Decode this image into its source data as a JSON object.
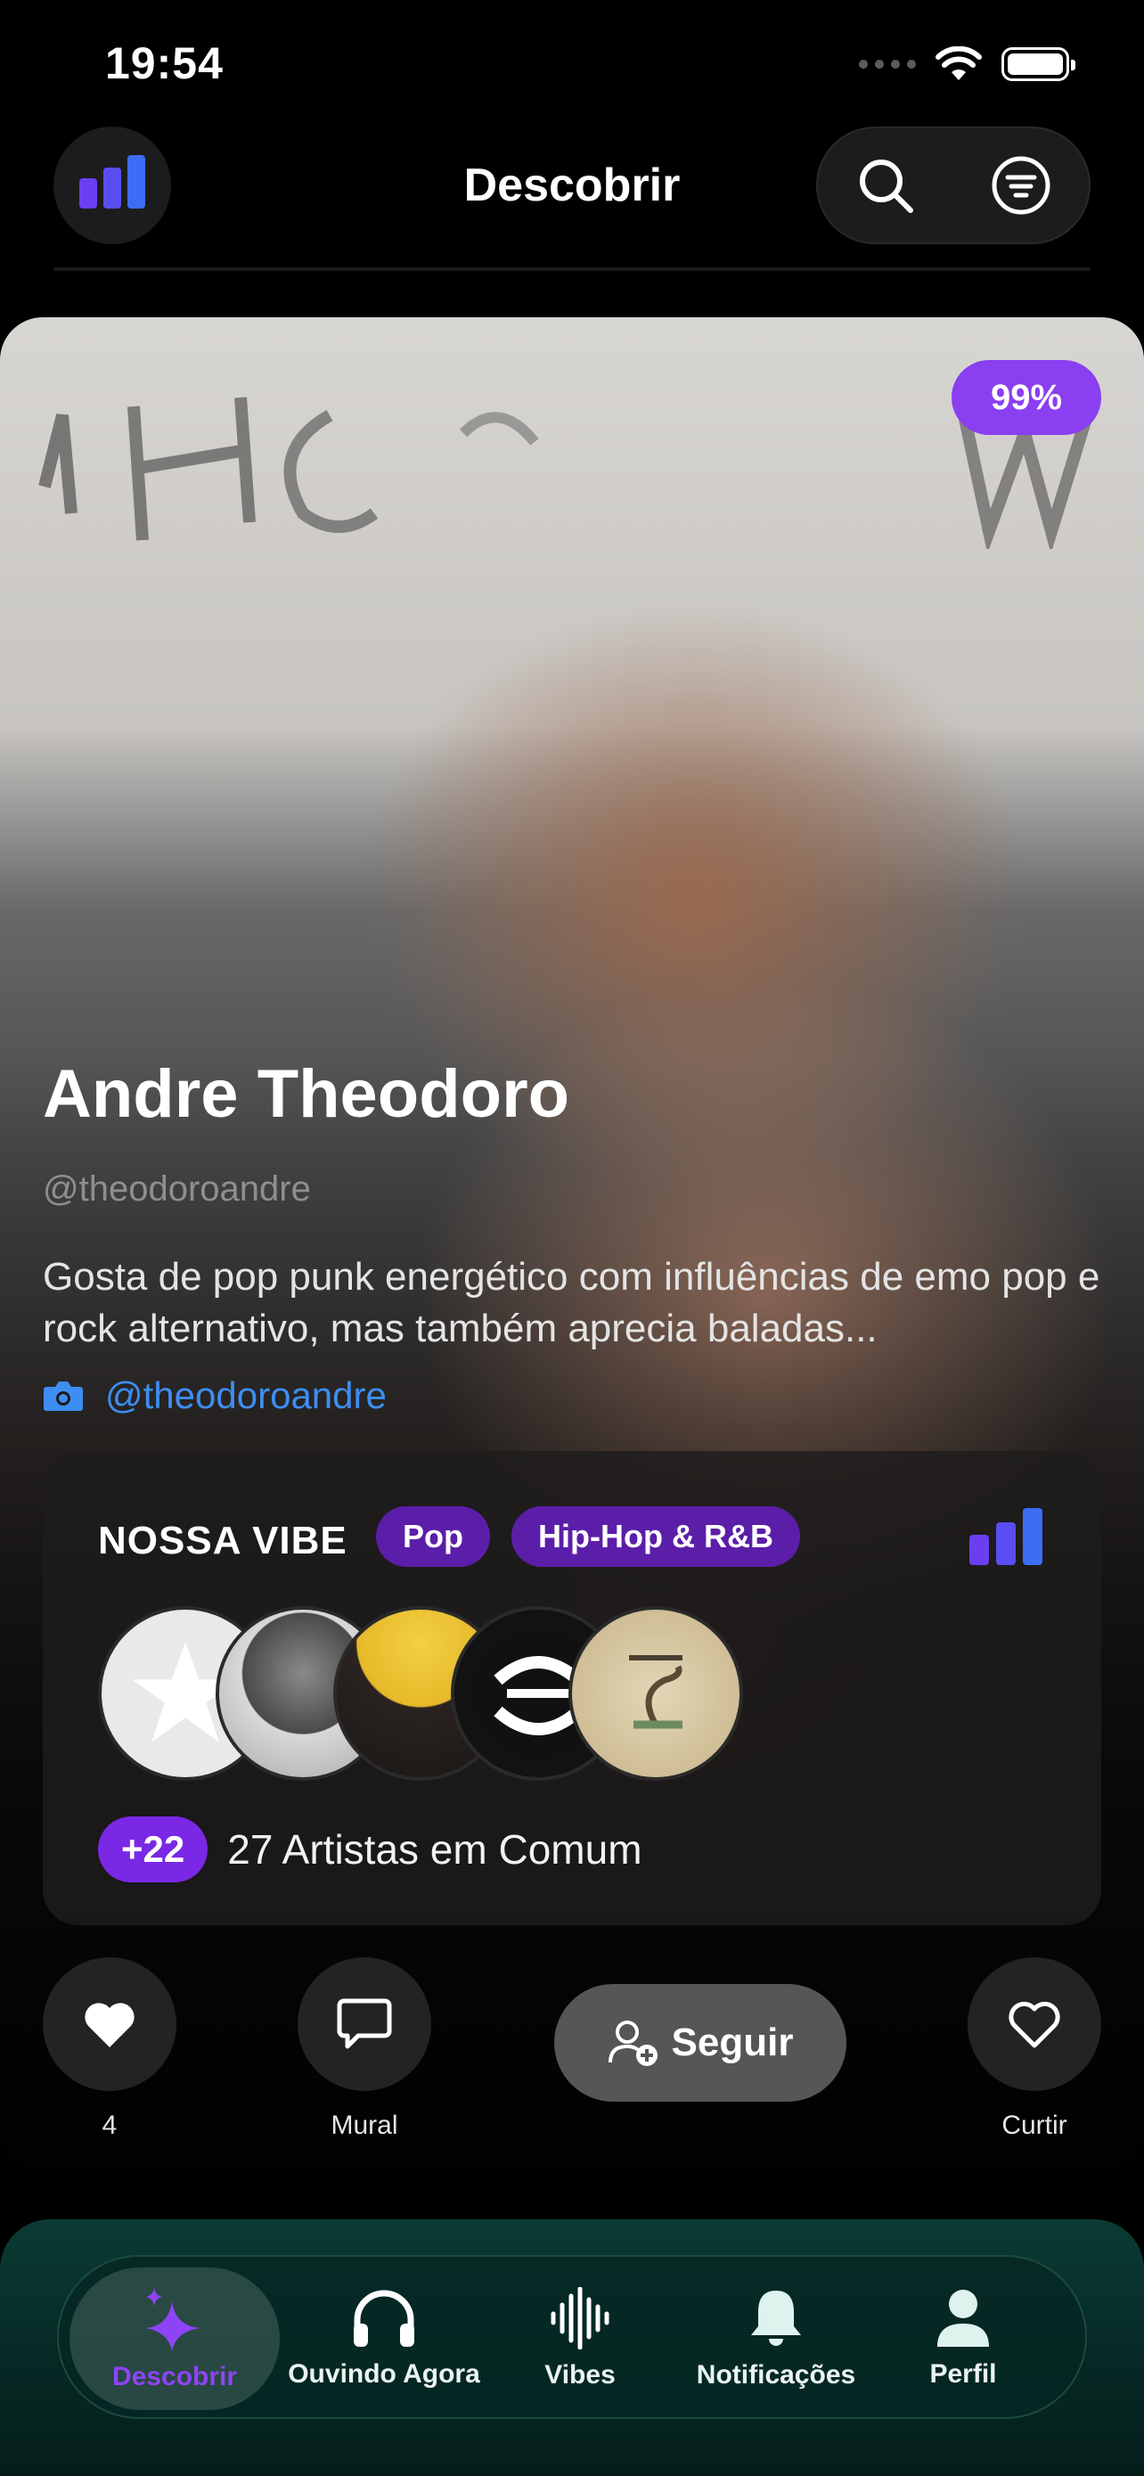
{
  "status_bar": {
    "time": "19:54"
  },
  "header": {
    "title": "Descobrir",
    "logo_icon": "app-logo-bars-icon",
    "search_icon": "search-icon",
    "filter_icon": "filter-icon"
  },
  "profile": {
    "match": "99%",
    "name": "Andre Theodoro",
    "username": "@theodoroandre",
    "bio": "Gosta de pop punk energético com influências de emo pop e rock alternativo, mas também aprecia baladas...",
    "instagram": "@theodoroandre"
  },
  "vibe": {
    "title": "NOSSA VIBE",
    "genres": [
      "Pop",
      "Hip-Hop & R&B"
    ],
    "extra_count": "+22",
    "common_text": "27 Artistas em Comum"
  },
  "actions": {
    "likes": {
      "count": "4",
      "icon": "heart-filled-icon"
    },
    "mural": {
      "label": "Mural",
      "icon": "chat-bubble-icon"
    },
    "follow": {
      "label": "Seguir",
      "icon": "user-plus-icon"
    },
    "curtir": {
      "label": "Curtir",
      "icon": "heart-outline-icon"
    }
  },
  "tabbar": {
    "tabs": [
      {
        "label": "Descobrir",
        "icon": "sparkles-icon",
        "active": true
      },
      {
        "label": "Ouvindo Agora",
        "icon": "headphones-icon"
      },
      {
        "label": "Vibes",
        "icon": "waveform-icon"
      },
      {
        "label": "Notificações",
        "icon": "bell-icon"
      },
      {
        "label": "Perfil",
        "icon": "person-icon"
      }
    ]
  },
  "colors": {
    "accent_purple": "#8a3ff0",
    "genre_bg": "#5b1ea8",
    "link_blue": "#3d8ef2",
    "tab_bg": "#062723"
  }
}
